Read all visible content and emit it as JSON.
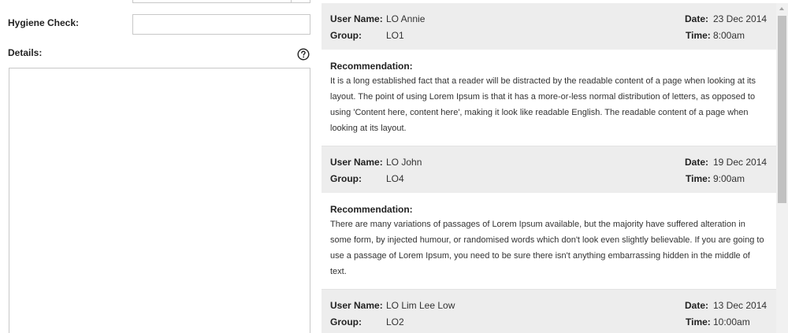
{
  "form": {
    "hygiene_label": "Hygiene Check:",
    "hygiene_value": "",
    "details_label": "Details:",
    "details_value": ""
  },
  "labels": {
    "user_name": "User Name:",
    "group": "Group:",
    "date": "Date:",
    "time": "Time:",
    "recommendation": "Recommendation:"
  },
  "records": [
    {
      "user_name": "LO Annie",
      "group": "LO1",
      "date": "23 Dec 2014",
      "time": "8:00am",
      "recommendation": "It is a long established fact that a reader will be distracted by the readable content of a page when looking at its layout. The point of using Lorem Ipsum is that it has a more-or-less normal distribution of letters, as opposed to using 'Content here, content here', making it look like readable English. The readable content of a page when looking at its layout."
    },
    {
      "user_name": "LO John",
      "group": "LO4",
      "date": "19 Dec 2014",
      "time": "9:00am",
      "recommendation": "There are many variations of passages of Lorem Ipsum available, but the majority have suffered alteration in some form, by injected humour, or randomised words which don't look even slightly believable. If you are going to use a passage of Lorem Ipsum, you need to be sure there isn't anything embarrassing hidden in the middle of text."
    },
    {
      "user_name": "LO Lim Lee Low",
      "group": "LO2",
      "date": "13 Dec 2014",
      "time": "10:00am",
      "recommendation": ""
    }
  ],
  "icons": {
    "help": "help-circle-icon",
    "scroll_up": "chevron-up-icon"
  },
  "colors": {
    "header_bg": "#ededed",
    "border": "#c8c8c8",
    "scroll_thumb": "#c1c1c1"
  }
}
